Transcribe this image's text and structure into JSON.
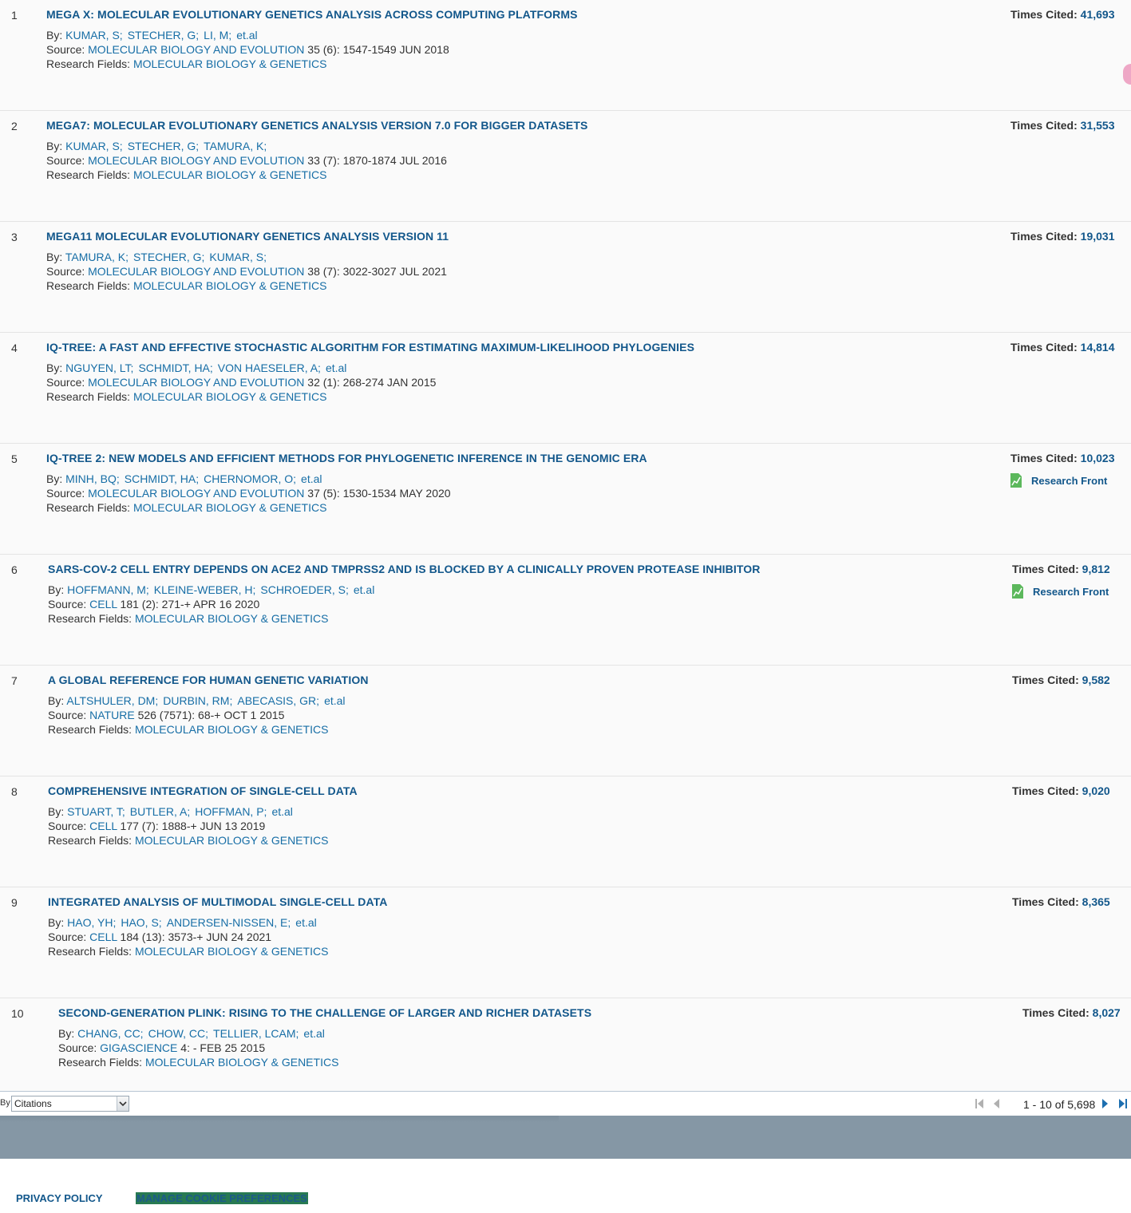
{
  "labels": {
    "by": "By:",
    "source": "Source:",
    "research_fields": "Research Fields:",
    "times_cited": "Times Cited:",
    "research_front": "Research Front"
  },
  "results": [
    {
      "rank": "1",
      "title": "MEGA X: MOLECULAR EVOLUTIONARY GENETICS ANALYSIS ACROSS COMPUTING PLATFORMS",
      "authors": [
        "KUMAR, S;",
        "STECHER, G;",
        "LI, M;",
        "et.al"
      ],
      "journal": "MOLECULAR BIOLOGY AND EVOLUTION",
      "citation": "35 (6): 1547-1549 JUN 2018",
      "field": "MOLECULAR BIOLOGY & GENETICS",
      "times_cited": "41,693",
      "research_front": false
    },
    {
      "rank": "2",
      "title": "MEGA7: MOLECULAR EVOLUTIONARY GENETICS ANALYSIS VERSION 7.0 FOR BIGGER DATASETS",
      "authors": [
        "KUMAR, S;",
        "STECHER, G;",
        "TAMURA, K;"
      ],
      "journal": "MOLECULAR BIOLOGY AND EVOLUTION",
      "citation": "33 (7): 1870-1874 JUL 2016",
      "field": "MOLECULAR BIOLOGY & GENETICS",
      "times_cited": "31,553",
      "research_front": false
    },
    {
      "rank": "3",
      "title": "MEGA11 MOLECULAR EVOLUTIONARY GENETICS ANALYSIS VERSION 11",
      "authors": [
        "TAMURA, K;",
        "STECHER, G;",
        "KUMAR, S;"
      ],
      "journal": "MOLECULAR BIOLOGY AND EVOLUTION",
      "citation": "38 (7): 3022-3027 JUL 2021",
      "field": "MOLECULAR BIOLOGY & GENETICS",
      "times_cited": "19,031",
      "research_front": false
    },
    {
      "rank": "4",
      "title": "IQ-TREE: A FAST AND EFFECTIVE STOCHASTIC ALGORITHM FOR ESTIMATING MAXIMUM-LIKELIHOOD PHYLOGENIES",
      "authors": [
        "NGUYEN, LT;",
        "SCHMIDT, HA;",
        "VON HAESELER, A;",
        "et.al"
      ],
      "journal": "MOLECULAR BIOLOGY AND EVOLUTION",
      "citation": "32 (1): 268-274 JAN 2015",
      "field": "MOLECULAR BIOLOGY & GENETICS",
      "times_cited": "14,814",
      "research_front": false
    },
    {
      "rank": "5",
      "title": "IQ-TREE 2: NEW MODELS AND EFFICIENT METHODS FOR PHYLOGENETIC INFERENCE IN THE GENOMIC ERA",
      "authors": [
        "MINH, BQ;",
        "SCHMIDT, HA;",
        "CHERNOMOR, O;",
        "et.al"
      ],
      "journal": "MOLECULAR BIOLOGY AND EVOLUTION",
      "citation": "37 (5): 1530-1534 MAY 2020",
      "field": "MOLECULAR BIOLOGY & GENETICS",
      "times_cited": "10,023",
      "research_front": true
    },
    {
      "rank": "6",
      "title": "SARS-COV-2 CELL ENTRY DEPENDS ON ACE2 AND TMPRSS2 AND IS BLOCKED BY A CLINICALLY PROVEN PROTEASE INHIBITOR",
      "authors": [
        "HOFFMANN, M;",
        "KLEINE-WEBER, H;",
        "SCHROEDER, S;",
        "et.al"
      ],
      "journal": "CELL",
      "citation": "181 (2): 271-+ APR 16 2020",
      "field": "MOLECULAR BIOLOGY & GENETICS",
      "times_cited": "9,812",
      "research_front": true
    },
    {
      "rank": "7",
      "title": "A GLOBAL REFERENCE FOR HUMAN GENETIC VARIATION",
      "authors": [
        "ALTSHULER, DM;",
        "DURBIN, RM;",
        "ABECASIS, GR;",
        "et.al"
      ],
      "journal": "NATURE",
      "citation": "526 (7571): 68-+ OCT 1 2015",
      "field": "MOLECULAR BIOLOGY & GENETICS",
      "times_cited": "9,582",
      "research_front": false
    },
    {
      "rank": "8",
      "title": "COMPREHENSIVE INTEGRATION OF SINGLE-CELL DATA",
      "authors": [
        "STUART, T;",
        "BUTLER, A;",
        "HOFFMAN, P;",
        "et.al"
      ],
      "journal": "CELL",
      "citation": "177 (7): 1888-+ JUN 13 2019",
      "field": "MOLECULAR BIOLOGY & GENETICS",
      "times_cited": "9,020",
      "research_front": false
    },
    {
      "rank": "9",
      "title": "INTEGRATED ANALYSIS OF MULTIMODAL SINGLE-CELL DATA",
      "authors": [
        "HAO, YH;",
        "HAO, S;",
        "ANDERSEN-NISSEN, E;",
        "et.al"
      ],
      "journal": "CELL",
      "citation": "184 (13): 3573-+ JUN 24 2021",
      "field": "MOLECULAR BIOLOGY & GENETICS",
      "times_cited": "8,365",
      "research_front": false
    },
    {
      "rank": "10",
      "title": "SECOND-GENERATION PLINK: RISING TO THE CHALLENGE OF LARGER AND RICHER DATASETS",
      "authors": [
        "CHANG, CC;",
        "CHOW, CC;",
        "TELLIER, LCAM;",
        "et.al"
      ],
      "journal": "GIGASCIENCE",
      "citation": "4: - FEB 25 2015",
      "field": "MOLECULAR BIOLOGY & GENETICS",
      "times_cited": "8,027",
      "research_front": false
    }
  ],
  "pager": {
    "sort_label": "By",
    "sort_value": "Citations",
    "range_text": "1 - 10 of 5,698"
  },
  "footer": {
    "privacy": "PRIVACY POLICY",
    "cookies": "MANAGE COOKIE PREFERENCES"
  },
  "colors": {
    "link": "#12578b",
    "band": "#8597a5",
    "research_front_icon": "#5cb85c",
    "cookie_highlight": "#287a52"
  }
}
